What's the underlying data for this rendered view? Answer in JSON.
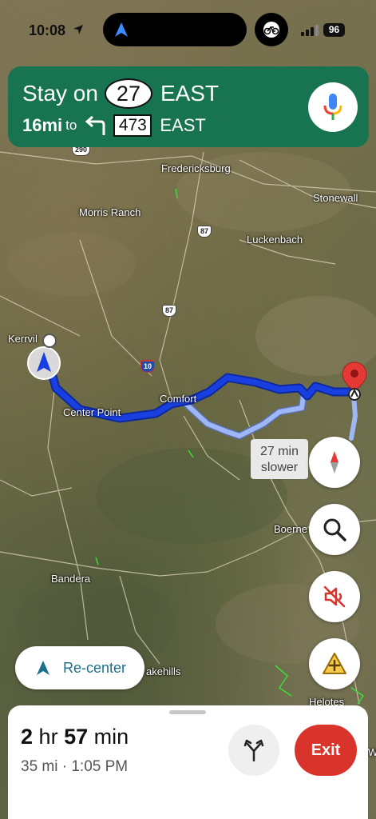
{
  "status_bar": {
    "time": "10:08",
    "battery": "96"
  },
  "banner": {
    "line1_prefix": "Stay on",
    "line1_route": "27",
    "line1_direction": "EAST",
    "distance": "16mi",
    "to": "to",
    "turn_icon": "turn-left-arrow-icon",
    "line2_route": "473",
    "line2_direction": "EAST",
    "bg_color": "#187350"
  },
  "map": {
    "places": {
      "fredericksburg": "Fredericksburg",
      "stonewall": "Stonewall",
      "morris_ranch": "Morris Ranch",
      "luckenbach": "Luckenbach",
      "kerrville": "Kerrvil",
      "center_point": "Center Point",
      "comfort": "Comfort",
      "boerne": "Boerne",
      "bandera": "Bandera",
      "lakehills": "akehills",
      "helotes": "Helotes",
      "edge_w": "W"
    },
    "shields": {
      "us87_a": "87",
      "us87_b": "87",
      "i10": "10",
      "us290": "290"
    },
    "alt_route_note": {
      "line1": "27 min",
      "line2": "slower"
    },
    "route_color": "#1a3fe0",
    "alt_route_color": "#9fb7f5"
  },
  "controls": {
    "recenter_label": "Re-center",
    "compass_icon": "compass-icon",
    "search_icon": "search-icon",
    "mute_icon": "speaker-muted-icon",
    "report_icon": "add-report-icon"
  },
  "trip": {
    "hours": "2",
    "hr_label": "hr",
    "minutes": "57",
    "min_label": "min",
    "distance": "35 mi",
    "separator": "·",
    "arrival": "1:05 PM",
    "exit_label": "Exit",
    "exit_color": "#d9342b"
  }
}
